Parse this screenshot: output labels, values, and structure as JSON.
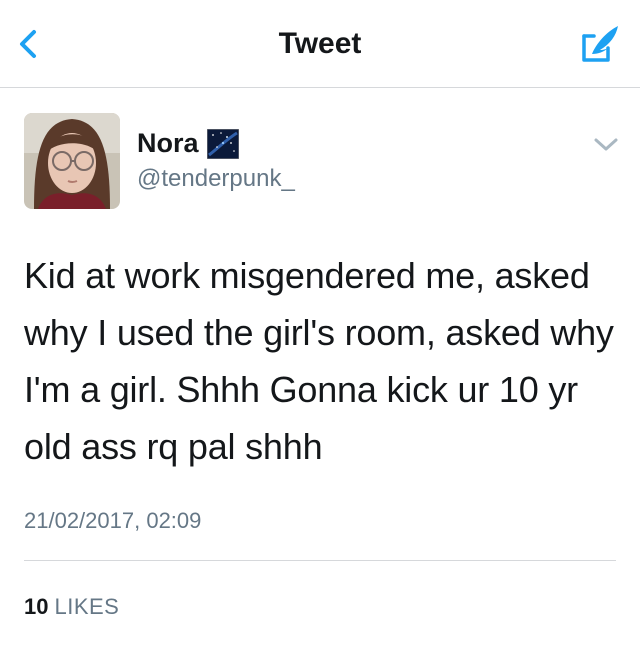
{
  "navbar": {
    "title": "Tweet",
    "back_icon": "chevron-left-icon",
    "compose_icon": "compose-quill-icon",
    "accent_color": "#1da1f2"
  },
  "tweet": {
    "author": {
      "display_name": "Nora",
      "handle": "@tenderpunk_",
      "badge_icon": "night-sky-emoji-icon"
    },
    "text": "Kid at work misgendered me, asked why I used the girl's room, asked why I'm a girl. Shhh Gonna kick ur 10 yr old ass rq pal shhh",
    "timestamp": "21/02/2017, 02:09",
    "likes_count": "10",
    "likes_label": "LIKES"
  },
  "colors": {
    "text_primary": "#14171a",
    "text_secondary": "#657786",
    "divider": "#d6d8db"
  }
}
